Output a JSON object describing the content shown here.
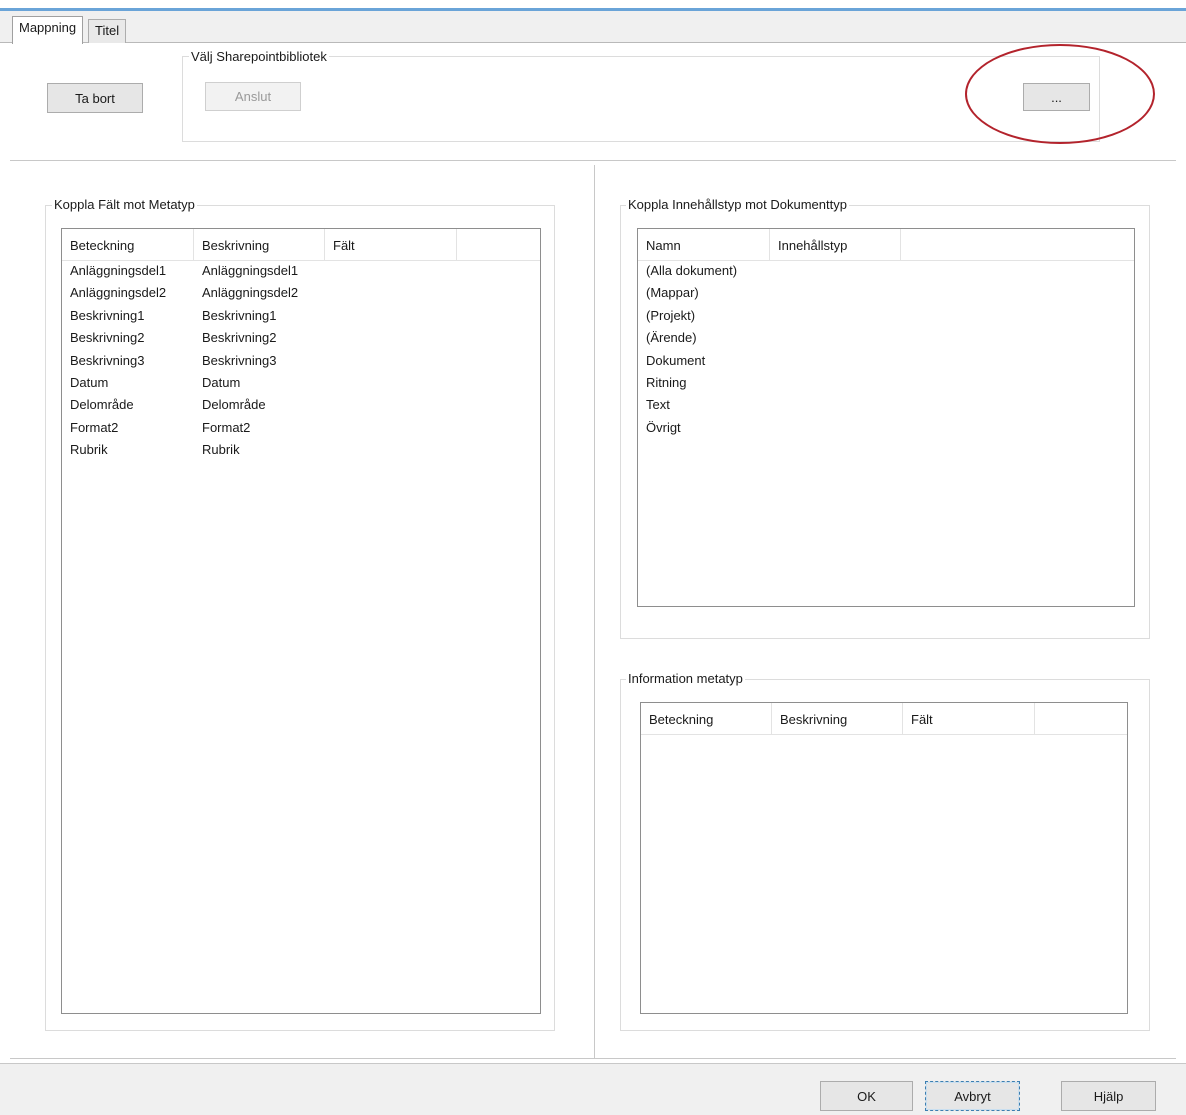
{
  "tabs": [
    {
      "label": "Mappning",
      "active": true
    },
    {
      "label": "Titel",
      "active": false
    }
  ],
  "toolbar": {
    "remove_label": "Ta bort",
    "sharepoint_group_title": "Välj Sharepointbibliotek",
    "connect_label": "Anslut",
    "browse_label": "..."
  },
  "fields_panel": {
    "title": "Koppla Fält mot Metatyp",
    "columns": [
      "Beteckning",
      "Beskrivning",
      "Fält"
    ],
    "rows": [
      [
        "Anläggningsdel1",
        "Anläggningsdel1",
        ""
      ],
      [
        "Anläggningsdel2",
        "Anläggningsdel2",
        ""
      ],
      [
        "Beskrivning1",
        "Beskrivning1",
        ""
      ],
      [
        "Beskrivning2",
        "Beskrivning2",
        ""
      ],
      [
        "Beskrivning3",
        "Beskrivning3",
        ""
      ],
      [
        "Datum",
        "Datum",
        ""
      ],
      [
        "Delområde",
        "Delområde",
        ""
      ],
      [
        "Format2",
        "Format2",
        ""
      ],
      [
        "Rubrik",
        "Rubrik",
        ""
      ]
    ]
  },
  "content_type_panel": {
    "title": "Koppla Innehållstyp mot Dokumenttyp",
    "columns": [
      "Namn",
      "Innehållstyp"
    ],
    "rows": [
      [
        "(Alla dokument)",
        ""
      ],
      [
        "(Mappar)",
        ""
      ],
      [
        "(Projekt)",
        ""
      ],
      [
        "(Ärende)",
        ""
      ],
      [
        "Dokument",
        ""
      ],
      [
        "Ritning",
        ""
      ],
      [
        "Text",
        ""
      ],
      [
        "Övrigt",
        ""
      ]
    ]
  },
  "metatype_info_panel": {
    "title": "Information metatyp",
    "columns": [
      "Beteckning",
      "Beskrivning",
      "Fält"
    ]
  },
  "footer": {
    "ok_label": "OK",
    "cancel_label": "Avbryt",
    "help_label": "Hjälp"
  },
  "colors": {
    "highlight_ellipse": "#b3232c",
    "window_accent": "#6aa4d8"
  }
}
